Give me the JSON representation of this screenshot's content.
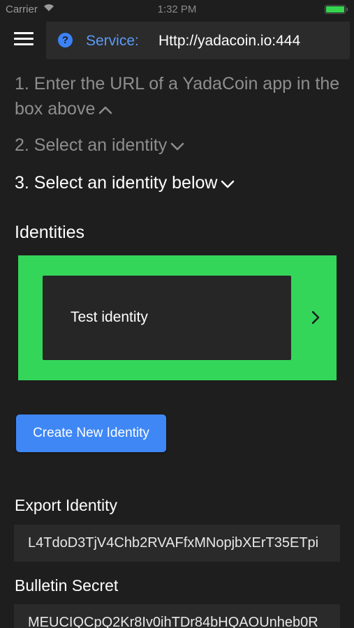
{
  "status_bar": {
    "carrier": "Carrier",
    "wifi_icon": "wifi-icon",
    "time": "1:32 PM",
    "battery_level": 1.0,
    "battery_color": "#35d44f"
  },
  "header": {
    "menu_icon": "hamburger-menu-icon",
    "help_icon": "help-circle-icon",
    "help_glyph": "?",
    "service_label": "Service:",
    "service_value": "Http://yadacoin.io:444"
  },
  "steps": [
    {
      "text": "1. Enter the URL of a YadaCoin app in the box above",
      "chevron": "chevron-up-icon",
      "active": false
    },
    {
      "text": "2. Select an identity",
      "chevron": "chevron-down-icon",
      "active": false
    },
    {
      "text": "3. Select an identity below",
      "chevron": "chevron-down-icon",
      "active": true
    }
  ],
  "identities": {
    "title": "Identities",
    "highlight_color": "#34d65a",
    "items": [
      {
        "label": "Test identity",
        "arrow_icon": "chevron-right-icon"
      }
    ]
  },
  "create_button": {
    "label": "Create New Identity",
    "color": "#3f87f5"
  },
  "export_identity": {
    "label": "Export Identity",
    "value": "L4TdoD3TjV4Chb2RVAFfxMNopjbXErT35ETpi"
  },
  "bulletin_secret": {
    "label": "Bulletin Secret",
    "value": "MEUCIQCpQ2Kr8Iv0ihTDr84bHQAOUnheb0R"
  }
}
